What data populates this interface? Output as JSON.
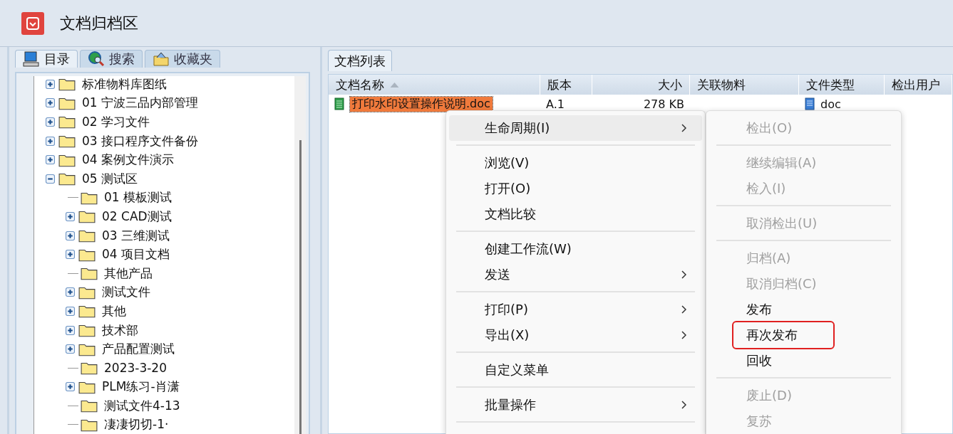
{
  "window": {
    "title": "文档归档区"
  },
  "left_tabs": [
    {
      "label": "目录",
      "selected": true
    },
    {
      "label": "搜索",
      "selected": false
    },
    {
      "label": "收藏夹",
      "selected": false
    }
  ],
  "tree": [
    {
      "label": "标准物料库图纸",
      "expandable": true,
      "expanded": false
    },
    {
      "label": "01  宁波三品内部管理",
      "expandable": true,
      "expanded": false
    },
    {
      "label": "02  学习文件",
      "expandable": true,
      "expanded": false
    },
    {
      "label": "03  接口程序文件备份",
      "expandable": true,
      "expanded": false
    },
    {
      "label": "04  案例文件演示",
      "expandable": true,
      "expanded": false
    },
    {
      "label": "05  测试区",
      "expandable": true,
      "expanded": true,
      "children": [
        {
          "label": "01  模板测试",
          "expandable": false
        },
        {
          "label": "02  CAD测试",
          "expandable": true,
          "expanded": false
        },
        {
          "label": "03  三维测试",
          "expandable": true,
          "expanded": false
        },
        {
          "label": "04  项目文档",
          "expandable": true,
          "expanded": false
        },
        {
          "label": "其他产品",
          "expandable": false
        },
        {
          "label": "测试文件",
          "expandable": true,
          "expanded": false
        },
        {
          "label": "其他",
          "expandable": true,
          "expanded": false
        },
        {
          "label": "技术部",
          "expandable": true,
          "expanded": false
        },
        {
          "label": "产品配置测试",
          "expandable": true,
          "expanded": false
        },
        {
          "label": "2023-3-20",
          "expandable": false
        },
        {
          "label": "PLM练习-肖潇",
          "expandable": true,
          "expanded": false
        },
        {
          "label": "测试文件4-13",
          "expandable": false
        },
        {
          "label": "凄凄切切-1·",
          "expandable": false
        }
      ]
    }
  ],
  "right_tabs": [
    {
      "label": "文档列表",
      "selected": true
    }
  ],
  "table": {
    "columns": [
      {
        "label": "文档名称",
        "sorted": true
      },
      {
        "label": "版本",
        "sorted": false
      },
      {
        "label": "大小",
        "sorted": false
      },
      {
        "label": "关联物料",
        "sorted": false
      },
      {
        "label": "文件类型",
        "sorted": false
      },
      {
        "label": "检出用户",
        "sorted": false
      }
    ],
    "rows": [
      {
        "selected": true,
        "cells": [
          "打印水印设置操作说明.doc",
          "A.1",
          "278 KB",
          "",
          "doc",
          ""
        ]
      }
    ]
  },
  "context_menu": {
    "items": [
      {
        "kind": "item",
        "label": "生命周期(I)",
        "submenu": true,
        "hovered": true
      },
      {
        "kind": "separator"
      },
      {
        "kind": "item",
        "label": "浏览(V)",
        "submenu": false,
        "hovered": false
      },
      {
        "kind": "item",
        "label": "打开(O)",
        "submenu": false,
        "hovered": false
      },
      {
        "kind": "item",
        "label": "文档比较",
        "submenu": false,
        "hovered": false
      },
      {
        "kind": "separator"
      },
      {
        "kind": "item",
        "label": "创建工作流(W)",
        "submenu": false,
        "hovered": false
      },
      {
        "kind": "item",
        "label": "发送",
        "submenu": true,
        "hovered": false
      },
      {
        "kind": "separator"
      },
      {
        "kind": "item",
        "label": "打印(P)",
        "submenu": true,
        "hovered": false
      },
      {
        "kind": "item",
        "label": "导出(X)",
        "submenu": true,
        "hovered": false
      },
      {
        "kind": "separator"
      },
      {
        "kind": "item",
        "label": "自定义菜单",
        "submenu": false,
        "hovered": false
      },
      {
        "kind": "separator"
      },
      {
        "kind": "item",
        "label": "批量操作",
        "submenu": true,
        "hovered": false
      },
      {
        "kind": "separator"
      }
    ]
  },
  "submenu": {
    "items": [
      {
        "kind": "item",
        "label": "检出(O)",
        "disabled": true,
        "outlined": false
      },
      {
        "kind": "separator"
      },
      {
        "kind": "item",
        "label": "继续编辑(A)",
        "disabled": true,
        "outlined": false
      },
      {
        "kind": "item",
        "label": "检入(I)",
        "disabled": true,
        "outlined": false
      },
      {
        "kind": "separator"
      },
      {
        "kind": "item",
        "label": "取消检出(U)",
        "disabled": true,
        "outlined": false
      },
      {
        "kind": "separator"
      },
      {
        "kind": "item",
        "label": "归档(A)",
        "disabled": true,
        "outlined": false
      },
      {
        "kind": "item",
        "label": "取消归档(C)",
        "disabled": true,
        "outlined": false
      },
      {
        "kind": "item",
        "label": "发布",
        "disabled": false,
        "outlined": false
      },
      {
        "kind": "item",
        "label": "再次发布",
        "disabled": false,
        "outlined": true
      },
      {
        "kind": "item",
        "label": "回收",
        "disabled": false,
        "outlined": false
      },
      {
        "kind": "separator"
      },
      {
        "kind": "item",
        "label": "废止(D)",
        "disabled": true,
        "outlined": false
      },
      {
        "kind": "item",
        "label": "复苏",
        "disabled": true,
        "outlined": false
      }
    ]
  }
}
